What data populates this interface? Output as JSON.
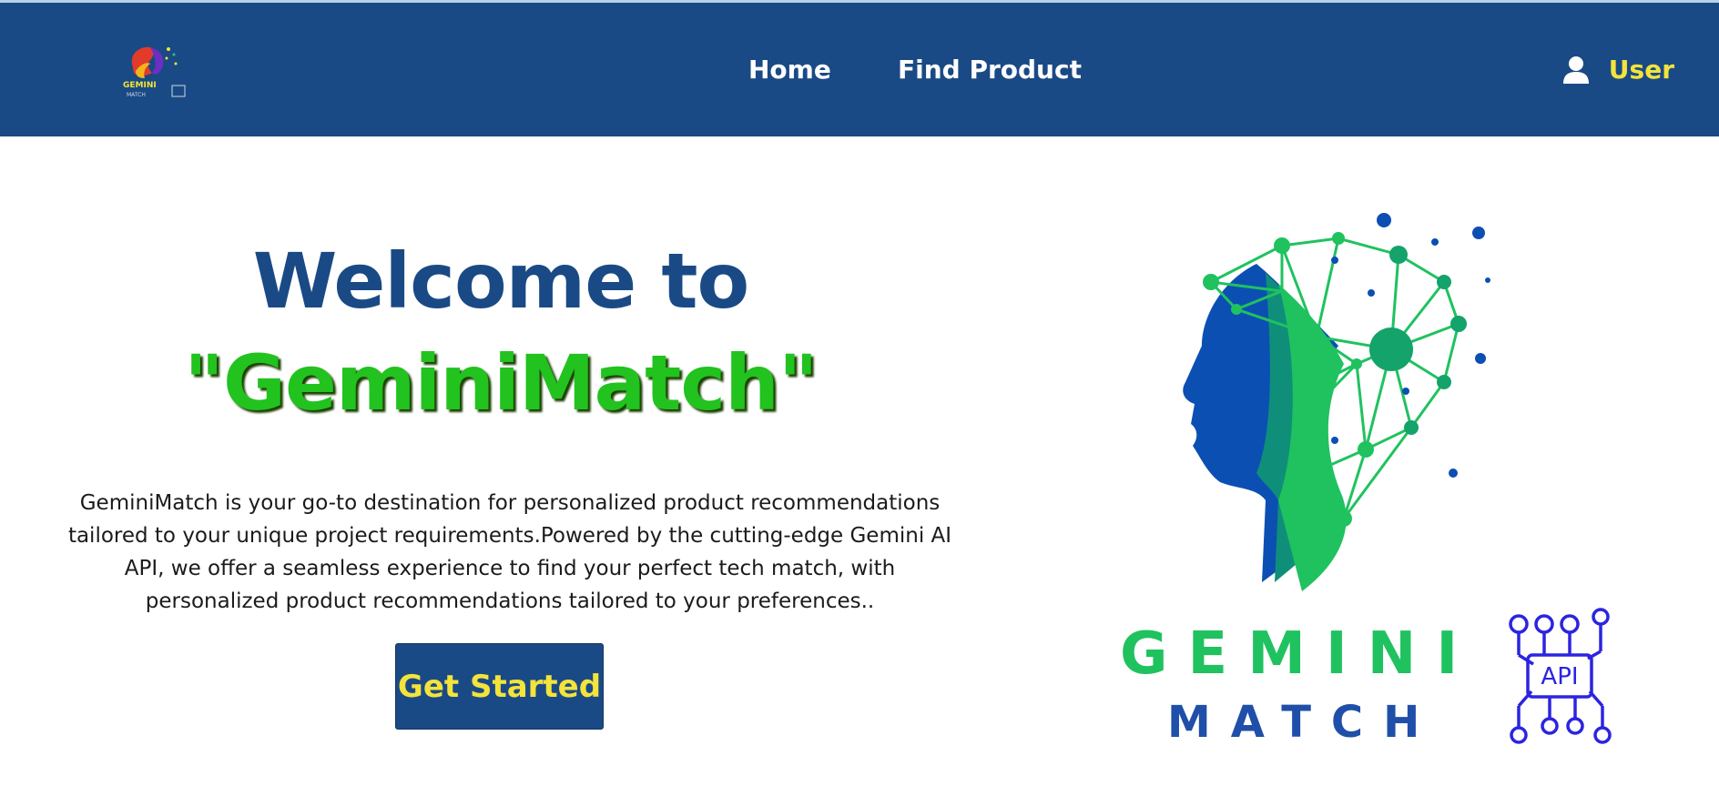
{
  "nav": {
    "logo_name": "gemini-match-logo",
    "links": [
      "Home",
      "Find Product"
    ],
    "user_icon": "user-icon",
    "user_label": "User"
  },
  "hero": {
    "title_line1": "Welcome to",
    "title_line2": "\"GeminiMatch\"",
    "description": "GeminiMatch is your go-to destination for personalized product recommendations tailored to your unique project requirements.Powered by the cutting-edge Gemini AI API, we offer a seamless experience to find your perfect tech match, with personalized product recommendations tailored to your preferences..",
    "cta_label": "Get Started"
  },
  "brand": {
    "word1": "GEMINI",
    "word2": "MATCH",
    "api_badge": "API"
  },
  "colors": {
    "navbar": "#1a4a85",
    "accent_yellow": "#f3e33b",
    "title_blue": "#1a4a85",
    "title_green": "#22c21f",
    "brand_green": "#1fc25f",
    "brand_blue": "#1f4fa8",
    "api_blue": "#2b24e0"
  }
}
